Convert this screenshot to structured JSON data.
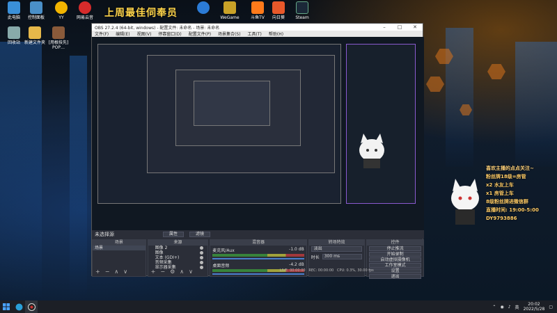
{
  "desktop": {
    "icons_top": [
      {
        "label": "此电脑",
        "color": "#3a8fd8"
      },
      {
        "label": "控制面板",
        "color": "#4a8fc8"
      },
      {
        "label": "YY",
        "color": "#f2b400"
      },
      {
        "label": "网易云音",
        "color": "#d62b2b"
      },
      {
        "label": "",
        "color": "#2b7bd6"
      },
      {
        "label": "WeGame",
        "color": "#c9a227"
      },
      {
        "label": "斗鱼TV",
        "color": "#ff7a1a"
      },
      {
        "label": "向日葵",
        "color": "#e8582a"
      },
      {
        "label": "Steam",
        "color": "#1b2838"
      }
    ],
    "icons_left": [
      {
        "label": "回收站",
        "color": "#8aa"
      },
      {
        "label": "新建文件夹",
        "color": "#e6b84a"
      },
      {
        "label": "[用根技先] POP…",
        "color": "#8a5a3a"
      }
    ],
    "banner": "上周最佳伺奉员"
  },
  "obs": {
    "title": "OBS 27.2.4 (64-bit, windows) - 配置文件: 未命名 - 场景: 未命名",
    "menu": [
      "文件(F)",
      "编辑(E)",
      "视图(V)",
      "停靠窗口(D)",
      "配置文件(P)",
      "场景集合(S)",
      "工具(T)",
      "帮助(H)"
    ],
    "scene_header": "未选择源",
    "scene_props": "属性",
    "scene_filters": "滤镜",
    "docks": {
      "scenes": {
        "title": "场景",
        "items": [
          "场景"
        ]
      },
      "sources": {
        "title": "来源",
        "items": [
          "图像 2",
          "图像",
          "文本 (GDI+)",
          "音频采集",
          "显示器采集"
        ]
      },
      "mixer": {
        "title": "混音器",
        "channels": [
          {
            "name": "麦克风/Aux",
            "db": "-1.0 dB"
          },
          {
            "name": "桌面音频",
            "db": "-4.2 dB"
          }
        ]
      },
      "transitions": {
        "title": "转场特效",
        "type": "淡出",
        "duration_label": "时长",
        "duration": "300 ms"
      },
      "controls": {
        "title": "控件",
        "buttons": [
          "停止推流",
          "开始录制",
          "启动虚拟摄像机",
          "工作室模式",
          "设置",
          "退出"
        ]
      }
    },
    "status": {
      "live": "LIVE: 00:00:00",
      "rec": "REC: 00:00:00",
      "cpu": "CPU: 0.3%, 30.00 fps"
    }
  },
  "overlay": {
    "lines": [
      "喜欢主播的点点关注~",
      "粉丝牌18级=房管",
      "x2 水友上车",
      "x1 房管上车",
      "8级粉丝牌进微信群",
      "直播时间: 19:00-5:00",
      "DY9793886"
    ]
  },
  "taskbar": {
    "time": "20:02",
    "date": "2022/5/28",
    "lang": "英"
  }
}
